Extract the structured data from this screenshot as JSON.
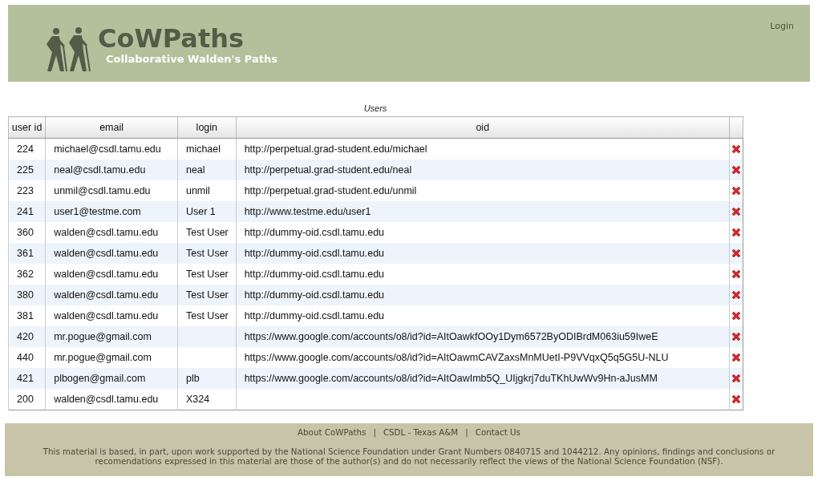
{
  "header": {
    "title": "CoWPaths",
    "subtitle": "Collaborative Walden's Paths",
    "login": "Login"
  },
  "table": {
    "caption": "Users",
    "columns": [
      "user id",
      "email",
      "login",
      "oid"
    ],
    "rows": [
      {
        "user_id": "224",
        "email": "michael@csdl.tamu.edu",
        "login": "michael",
        "oid": "http://perpetual.grad-student.edu/michael"
      },
      {
        "user_id": "225",
        "email": "neal@csdl.tamu.edu",
        "login": "neal",
        "oid": "http://perpetual.grad-student.edu/neal"
      },
      {
        "user_id": "223",
        "email": "unmil@csdl.tamu.edu",
        "login": "unmil",
        "oid": "http://perpetual.grad-student.edu/unmil"
      },
      {
        "user_id": "241",
        "email": "user1@testme.com",
        "login": "User 1",
        "oid": "http://www.testme.edu/user1"
      },
      {
        "user_id": "360",
        "email": "walden@csdl.tamu.edu",
        "login": "Test User",
        "oid": "http://dummy-oid.csdl.tamu.edu"
      },
      {
        "user_id": "361",
        "email": "walden@csdl.tamu.edu",
        "login": "Test User",
        "oid": "http://dummy-oid.csdl.tamu.edu"
      },
      {
        "user_id": "362",
        "email": "walden@csdl.tamu.edu",
        "login": "Test User",
        "oid": "http://dummy-oid.csdl.tamu.edu"
      },
      {
        "user_id": "380",
        "email": "walden@csdl.tamu.edu",
        "login": "Test User",
        "oid": "http://dummy-oid.csdl.tamu.edu"
      },
      {
        "user_id": "381",
        "email": "walden@csdl.tamu.edu",
        "login": "Test User",
        "oid": "http://dummy-oid.csdl.tamu.edu"
      },
      {
        "user_id": "420",
        "email": "mr.pogue@gmail.com",
        "oid": "https://www.google.com/accounts/o8/id?id=AItOawkfOOy1Dym6572ByODIBrdM063iu59IweE"
      },
      {
        "user_id": "440",
        "email": "mr.pogue@gmail.com",
        "oid": "https://www.google.com/accounts/o8/id?id=AItOawmCAVZaxsMnMUetI-P9VVqxQ5q5G5U-NLU"
      },
      {
        "user_id": "421",
        "email": "plbogen@gmail.com",
        "login": "plb",
        "oid": "https://www.google.com/accounts/o8/id?id=AItOawImb5Q_UIjgkrj7duTKhUwWv9Hn-aJusMM"
      },
      {
        "user_id": "200",
        "email": "walden@csdl.tamu.edu",
        "login": "X324"
      }
    ]
  },
  "footer": {
    "links": [
      "About CoWPaths",
      "CSDL - Texas A&M",
      "Contact Us"
    ],
    "separator": "|",
    "notice": "This material is based, in part, upon work supported by the National Science Foundation under Grant Numbers 0840715 and 1044212. Any opinions, findings and conclusions or recomendations expressed in this material are those of the author(s) and do not necessarily reflect the views of the National Science Foundation (NSF)."
  }
}
